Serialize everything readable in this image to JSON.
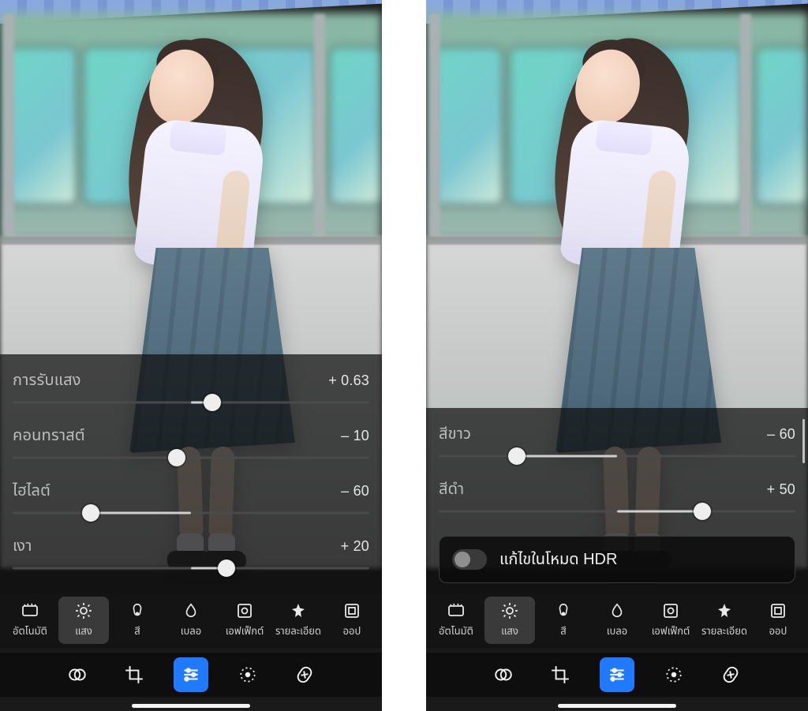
{
  "left": {
    "sliders": [
      {
        "label": "การรับแสง",
        "value": "+ 0.63",
        "pct": 56
      },
      {
        "label": "คอนทราสต์",
        "value": "– 10",
        "pct": 46
      },
      {
        "label": "ไฮไลต์",
        "value": "– 60",
        "pct": 22
      },
      {
        "label": "เงา",
        "value": "+ 20",
        "pct": 60
      }
    ]
  },
  "right": {
    "sliders": [
      {
        "label": "สีขาว",
        "value": "– 60",
        "pct": 22
      },
      {
        "label": "สีดำ",
        "value": "+ 50",
        "pct": 74
      }
    ],
    "hdr_label": "แก้ไขในโหมด HDR"
  },
  "tabs": [
    {
      "key": "auto",
      "label": "อัตโนมัติ"
    },
    {
      "key": "light",
      "label": "แสง"
    },
    {
      "key": "color",
      "label": "สี"
    },
    {
      "key": "blur",
      "label": "เบลอ"
    },
    {
      "key": "effects",
      "label": "เอฟเฟ็กต์"
    },
    {
      "key": "detail",
      "label": "รายละเอียด"
    },
    {
      "key": "optics",
      "label": "ออป"
    }
  ],
  "active_tab": "light",
  "colors": {
    "accent": "#2179ff"
  }
}
